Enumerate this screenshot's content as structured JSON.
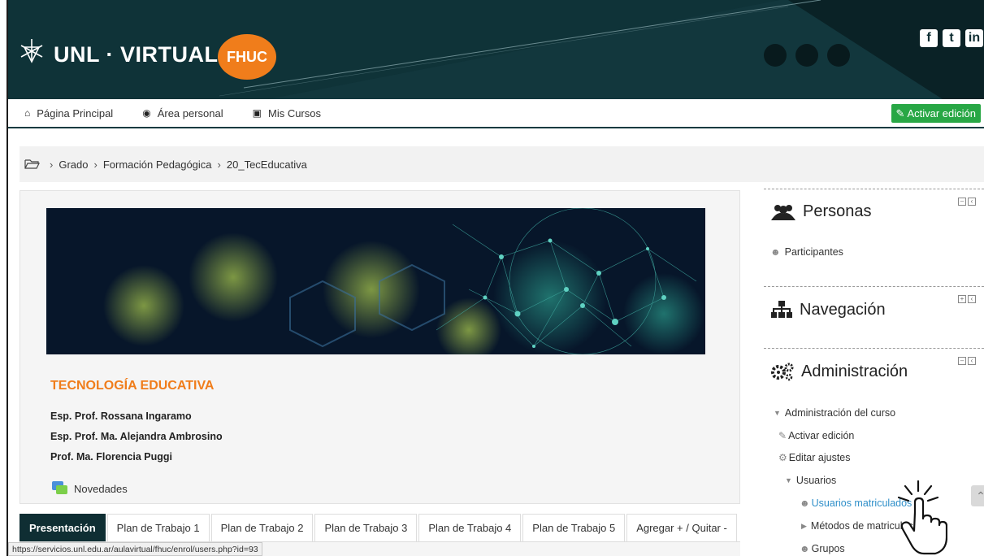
{
  "header": {
    "brand": "UNL · VIRTUAL",
    "badge": "FHUC",
    "social": [
      {
        "icon": "facebook-icon",
        "glyph": "f"
      },
      {
        "icon": "twitter-icon",
        "glyph": "t"
      },
      {
        "icon": "linkedin-icon",
        "glyph": "in"
      }
    ]
  },
  "nav": {
    "home": "Página Principal",
    "personal": "Área personal",
    "courses": "Mis Cursos",
    "edit_button": "Activar edición"
  },
  "breadcrumb": {
    "items": [
      "Grado",
      "Formación Pedagógica",
      "20_TecEducativa"
    ]
  },
  "course": {
    "title": "TECNOLOGÍA EDUCATIVA",
    "professors": [
      "Esp. Prof. Rossana Ingaramo",
      "Esp. Prof. Ma. Alejandra Ambrosino",
      "Prof. Ma. Florencia Puggi"
    ],
    "news": "Novedades"
  },
  "tabs": [
    "Presentación",
    "Plan de Trabajo 1",
    "Plan de Trabajo 2",
    "Plan de Trabajo 3",
    "Plan de Trabajo 4",
    "Plan de Trabajo 5",
    "Agregar + / Quitar -"
  ],
  "status_url": "https://servicios.unl.edu.ar/aulavirtual/fhuc/enrol/users.php?id=93",
  "sidebar": {
    "personas": {
      "title": "Personas",
      "items": [
        "Participantes"
      ]
    },
    "navegacion": {
      "title": "Navegación"
    },
    "administracion": {
      "title": "Administración",
      "items": [
        "Administración del curso",
        "Activar edición",
        "Editar ajustes",
        "Usuarios",
        "Usuarios matriculados",
        "Métodos de matriculación",
        "Grupos"
      ]
    }
  },
  "colors": {
    "brand_dark": "#0f2e33",
    "accent_orange": "#f07d1b",
    "edit_green": "#28a745",
    "link_blue": "#2f8fc9"
  }
}
